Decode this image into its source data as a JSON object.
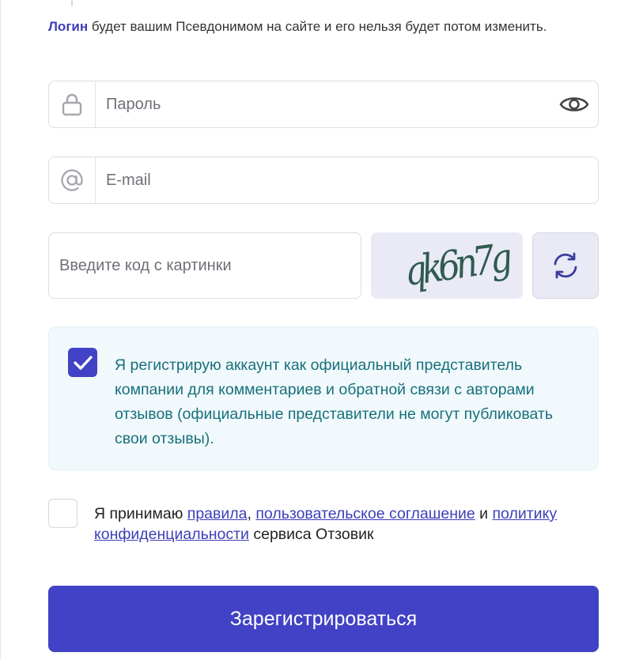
{
  "hint": {
    "highlight": "Логин",
    "text": " будет вашим Псевдонимом на сайте и его нельзя будет потом изменить."
  },
  "password": {
    "placeholder": "Пароль",
    "value": ""
  },
  "email": {
    "placeholder": "E-mail",
    "value": ""
  },
  "captcha": {
    "placeholder": "Введите код с картинки",
    "value": "",
    "image_text": "qk6n7g"
  },
  "official": {
    "checked": true,
    "text": "Я регистрирую аккаунт как официальный представитель компании для комментариев и обратной связи с авторами отзывов (официальные представители не могут публиковать свои отзывы)."
  },
  "agree": {
    "checked": false,
    "prefix": "Я принимаю ",
    "rules_link": "правила",
    "comma": ", ",
    "user_agreement_link": "пользовательское соглашение",
    "and": " и ",
    "privacy_link": "политику конфиденциальности",
    "suffix": " сервиса Отзовик"
  },
  "submit": {
    "label": "Зарегистрироваться"
  },
  "colors": {
    "accent": "#4142c5",
    "link": "#3d3fb8",
    "official_text": "#17707c",
    "official_bg": "#f1f9fc"
  },
  "icons": {
    "password": "lock-icon",
    "show_password": "eye-icon",
    "email": "at-sign-icon",
    "refresh": "refresh-icon",
    "checkbox": "checkmark-icon"
  }
}
